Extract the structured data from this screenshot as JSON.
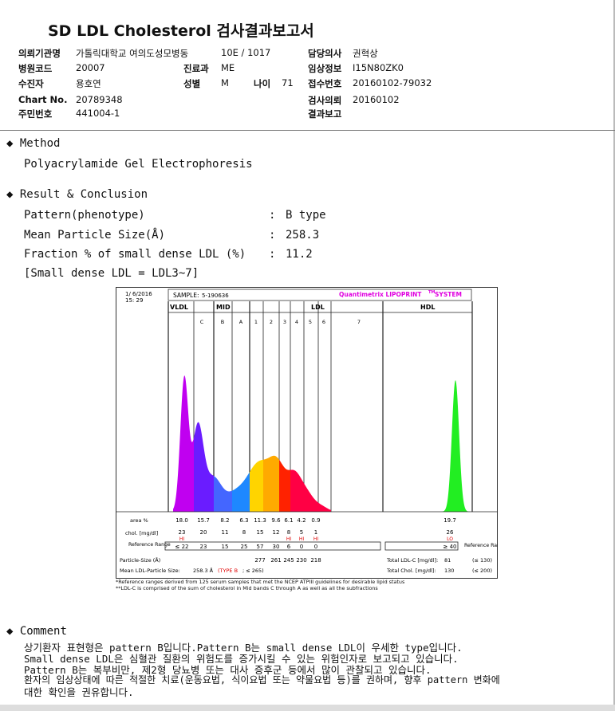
{
  "report": {
    "title": "SD LDL Cholesterol 검사결과보고서"
  },
  "header": {
    "institution_label": "의뢰기관명",
    "institution": "가톨릭대학교 여의도성모병동",
    "ward": "10E / 1017",
    "doctor_label": "담당의사",
    "doctor": "권혁상",
    "hospital_code_label": "병원코드",
    "hospital_code": "20007",
    "department_label": "진료과",
    "department": "ME",
    "clinical_info_label": "임상정보",
    "clinical_info": "I15N80ZK0",
    "patient_label": "수진자",
    "patient": "용호연",
    "sex_label": "성별",
    "sex": "M",
    "age_label": "나이",
    "age": "71",
    "receipt_label": "접수번호",
    "receipt": "20160102-79032",
    "chart_label": "Chart No.",
    "chart": "20789348",
    "test_request_label": "검사의뢰",
    "test_request": "20160102",
    "resident_label": "주민번호",
    "resident": "441004-1",
    "result_report_label": "결과보고",
    "result_report": ""
  },
  "method": {
    "heading": "Method",
    "text": "Polyacrylamide Gel Electrophoresis"
  },
  "result": {
    "heading": "Result & Conclusion",
    "pattern_label": "Pattern(phenotype)",
    "pattern_value": "B type",
    "size_label": "Mean Particle Size(Å)",
    "size_value": "258.3",
    "fraction_label": "Fraction % of small dense LDL (%)",
    "fraction_value": "11.2",
    "note": "[Small dense LDL = LDL3~7]",
    "colon": ":"
  },
  "chart_data": {
    "type": "area",
    "date": "1/ 6/2016",
    "time": "15: 29",
    "sample_label": "SAMPLE:",
    "sample": "5-190636",
    "brand": "Quantimetrix LIPOPRINT",
    "brand_sup": "TM",
    "brand_suffix": "SYSTEM",
    "groups": [
      "VLDL",
      "MID",
      "LDL",
      "HDL"
    ],
    "bands": [
      "C",
      "B",
      "A",
      "1",
      "2",
      "3",
      "4",
      "5",
      "6",
      "7"
    ],
    "area_label": "area %",
    "area": [
      "18.0",
      "15.7",
      "8.2",
      "6.3",
      "11.3",
      "9.6",
      "6.1",
      "4.2",
      "0.9",
      "19.7"
    ],
    "chol_label": "chol. [mg/dl]",
    "chol": [
      "23",
      "20",
      "11",
      "8",
      "15",
      "12",
      "8",
      "5",
      "1",
      "26"
    ],
    "chol_flags": [
      "HI",
      "",
      "",
      "",
      "",
      "",
      "HI",
      "HI",
      "HI",
      "LO"
    ],
    "ref_label": "Reference Range",
    "ref": [
      "≤ 22",
      "23",
      "15",
      "25",
      "57",
      "30",
      "6",
      "0",
      "0",
      "≥ 40"
    ],
    "ref_label_right": "Reference Range",
    "psize_label": "Particle-Size (Å)",
    "psize": [
      "277",
      "261",
      "245",
      "230",
      "218"
    ],
    "mean_label": "Mean LDL-Particle Size:",
    "mean_value": "258.3 Å",
    "mean_type": "(TYPE B",
    "mean_ref": "; ≤ 265)",
    "total_ldl_label": "Total LDL-C [mg/dl]:",
    "total_ldl": "81",
    "total_ldl_ref": "(≤ 130)",
    "total_chol_label": "Total Chol. [mg/dl]:",
    "total_chol": "130",
    "total_chol_ref": "(≤ 200)",
    "footnote1": "*Reference ranges derived from 125 serum samples that met the NCEP ATPIII guidelines for desirable lipid status",
    "footnote2": "**LDL-C is comprised of the sum of cholesterol in Mid bands C through A as well as all the subfractions",
    "colors": {
      "vldl": "#c000f0",
      "c": "#6a1cff",
      "b": "#4466ff",
      "a": "#1e88ff",
      "ldl1": "#ffd400",
      "ldl2": "#ffaa00",
      "ldl3": "#ff2200",
      "ldl_tail": "#ff0044",
      "hdl": "#22ee22",
      "brand": "#e000e0",
      "flag": "#e00000"
    }
  },
  "comment": {
    "heading": "Comment",
    "lines": [
      "상기환자 표현형은 pattern B입니다.Pattern B는 small dense LDL이 우세한 type입니다.",
      "Small dense LDL은 심혈관 질환의 위험도를 증가시킬 수 있는 위험인자로 보고되고 있습니다.",
      "Pattern B는 복부비만, 제2형 당뇨병 또는 대사 증후군 등에서 많이 관찰되고 있습니다.",
      "환자의 임상상태에 따른 적절한 치료(운동요법, 식이요법 또는 약물요법 등)를 권하며, 향후 pattern 변화에",
      "대한 확인을 권유합니다."
    ]
  }
}
